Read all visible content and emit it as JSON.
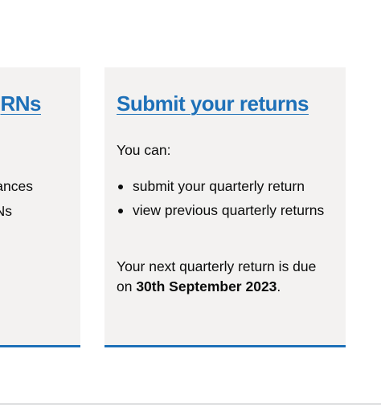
{
  "cards": [
    {
      "title": "RNs",
      "lines": [
        "ances",
        "Ns"
      ]
    },
    {
      "title": "Submit your returns",
      "intro": "You can:",
      "items": [
        "submit your quarterly return",
        "view previous quarterly returns"
      ],
      "due_prefix": "Your next quarterly return is due on ",
      "due_date": "30th September 2023",
      "due_suffix": "."
    }
  ]
}
